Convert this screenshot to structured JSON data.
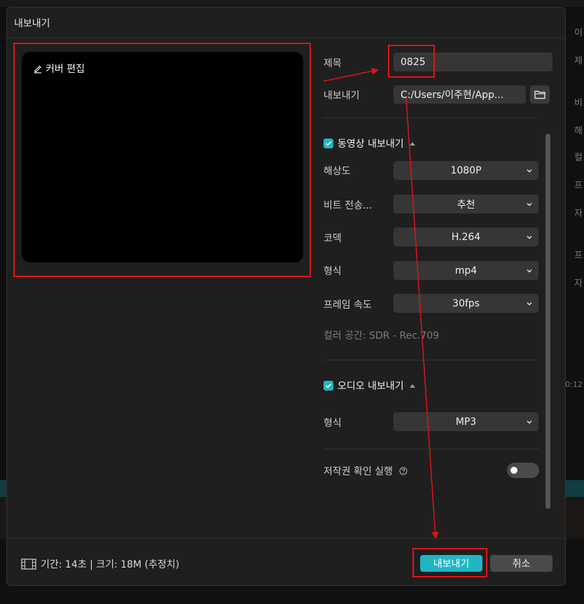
{
  "background": {
    "right_letters": [
      "이",
      "제",
      "비",
      "해",
      "컬",
      "프",
      "자",
      "프",
      "자"
    ],
    "right_timecode": "0:12"
  },
  "dialog": {
    "title": "내보내기",
    "cover_edit_label": "커버 편집",
    "fields": {
      "title_label": "제목",
      "title_value": "0825",
      "export_label": "내보내기",
      "export_path": "C:/Users/이주현/App..."
    },
    "video_section": {
      "label": "동영상 내보내기",
      "checked": true,
      "rows": [
        {
          "label": "해상도",
          "value": "1080P"
        },
        {
          "label": "비트 전송...",
          "value": "추천"
        },
        {
          "label": "코덱",
          "value": "H.264"
        },
        {
          "label": "형식",
          "value": "mp4"
        },
        {
          "label": "프레임 속도",
          "value": "30fps"
        }
      ],
      "color_space": "컬러 공간: SDR - Rec.709"
    },
    "audio_section": {
      "label": "오디오 내보내기",
      "checked": true,
      "rows": [
        {
          "label": "형식",
          "value": "MP3"
        }
      ]
    },
    "copyright": {
      "label": "저작권 확인 실행",
      "enabled": false
    },
    "footer": {
      "info": "기간: 14초 | 크기: 18M (추정치)",
      "export_button": "내보내기",
      "cancel_button": "취소"
    }
  },
  "colors": {
    "accent": "#1fb6c2",
    "annotation_red": "#e01414"
  },
  "icons": [
    "pencil-icon",
    "folder-icon",
    "checkbox-checked-icon",
    "chevron-down-icon",
    "help-icon",
    "film-icon"
  ]
}
